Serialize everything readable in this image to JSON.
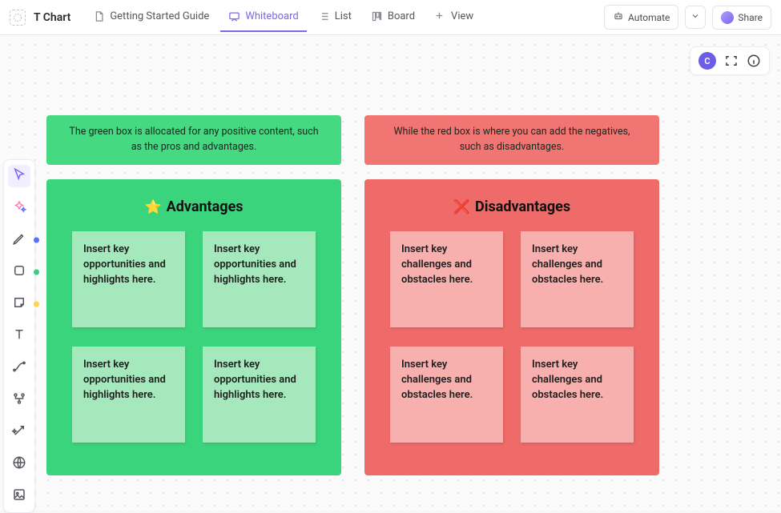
{
  "header": {
    "title": "T Chart",
    "tabs": [
      {
        "id": "guide",
        "label": "Getting Started Guide"
      },
      {
        "id": "whiteboard",
        "label": "Whiteboard"
      },
      {
        "id": "list",
        "label": "List"
      },
      {
        "id": "board",
        "label": "Board"
      },
      {
        "id": "addview",
        "label": "View"
      }
    ],
    "automate_label": "Automate",
    "share_label": "Share"
  },
  "floating": {
    "user_initial": "C"
  },
  "descriptions": {
    "green": "The green box is allocated for any positive content, such as the pros and advantages.",
    "red": "While the red box is where you can add the negatives, such as disadvantages."
  },
  "panels": {
    "advantages": {
      "emoji": "⭐",
      "title": "Advantages",
      "notes": [
        "Insert key opportunities and highlights here.",
        "Insert key opportunities and highlights here.",
        "Insert key opportunities and highlights here.",
        "Insert key opportunities and highlights here."
      ]
    },
    "disadvantages": {
      "emoji": "❌",
      "title": "Disadvantages",
      "notes": [
        "Insert key challenges and obstacles here.",
        "Insert key challenges and obstacles here.",
        "Insert key challenges and obstacles here.",
        "Insert key challenges and obstacles here."
      ]
    }
  },
  "colors": {
    "green_desc_bg": "#45d982",
    "red_desc_bg": "#f17573",
    "green_panel_bg": "#3ad47c",
    "red_panel_bg": "#ee6b69",
    "dot_blue": "#5b6cff",
    "dot_green": "#33d17a",
    "dot_yellow": "#ffd54a"
  },
  "dock": {
    "tools": [
      "cursor-icon",
      "sparkle-icon",
      "pen-icon",
      "shape-icon",
      "stickynote-icon",
      "text-icon",
      "connector-icon",
      "diagram-icon",
      "magic-icon",
      "web-icon",
      "image-icon"
    ]
  }
}
